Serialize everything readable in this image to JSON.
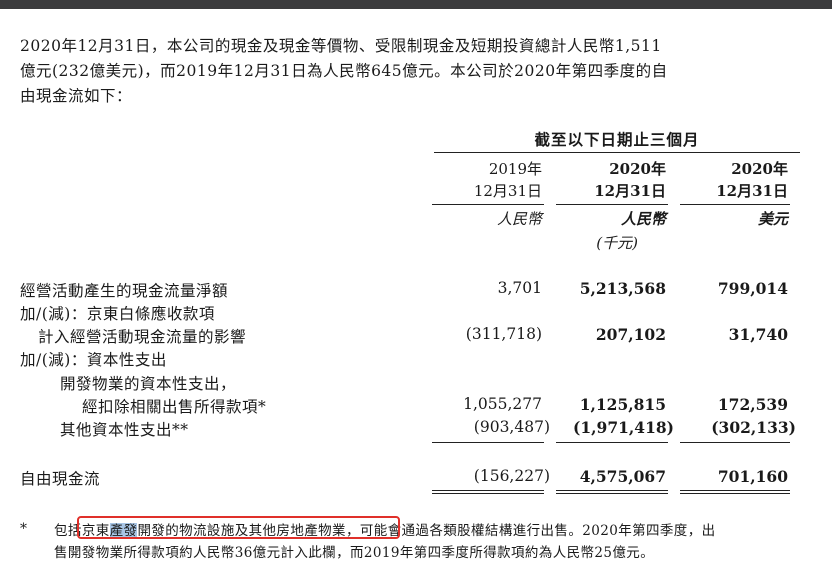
{
  "paragraph": {
    "line1": "2020年12月31日，本公司的現金及現金等價物、受限制現金及短期投資總計人民幣1,511",
    "line2": "億元(232億美元)，而2019年12月31日為人民幣645億元。本公司於2020年第四季度的自",
    "line3": "由現金流如下："
  },
  "table": {
    "period_header": "截至以下日期止三個月",
    "columns": [
      {
        "year": "2019年",
        "date": "12月31日",
        "currency": "人民幣",
        "unit": ""
      },
      {
        "year": "2020年",
        "date": "12月31日",
        "currency": "人民幣",
        "unit": "(千元)"
      },
      {
        "year": "2020年",
        "date": "12月31日",
        "currency": "美元",
        "unit": ""
      }
    ],
    "rows": [
      {
        "label": "經營活動產生的現金流量淨額",
        "values": [
          "3,701",
          "5,213,568",
          "799,014"
        ]
      },
      {
        "label": "加/(減)：京東白條應收款項",
        "values": [
          "",
          "",
          ""
        ]
      },
      {
        "label": "計入經營活動現金流量的影響",
        "values": [
          "(311,718)",
          "207,102",
          "31,740"
        ]
      },
      {
        "label": "加/(減)：資本性支出",
        "values": [
          "",
          "",
          ""
        ]
      },
      {
        "label": "開發物業的資本性支出，",
        "values": [
          "",
          "",
          ""
        ]
      },
      {
        "label": "經扣除相關出售所得款項*",
        "values": [
          "1,055,277",
          "1,125,815",
          "172,539"
        ]
      },
      {
        "label": "其他資本性支出**",
        "values": [
          "(903,487)",
          "(1,971,418)",
          "(302,133)"
        ]
      },
      {
        "label": "自由現金流",
        "values": [
          "(156,227)",
          "4,575,067",
          "701,160"
        ]
      }
    ]
  },
  "footnote": {
    "marker": "*",
    "prefix": "包括",
    "boxed_a": "京東",
    "boxed_highlight": "產發",
    "boxed_b": "開發的物流設施及其他房地產物業",
    "rest1": "，可能會通過各類股權結構進行出售。2020年第四季度，出",
    "line2": "售開發物業所得款項約人民幣36億元計入此欄，而2019年第四季度所得款項約為人民幣25億元。"
  },
  "colors": {
    "highlight": "#a9c6e6",
    "annotation_box": "#e0302a",
    "top_bar": "#3b3b3d"
  }
}
